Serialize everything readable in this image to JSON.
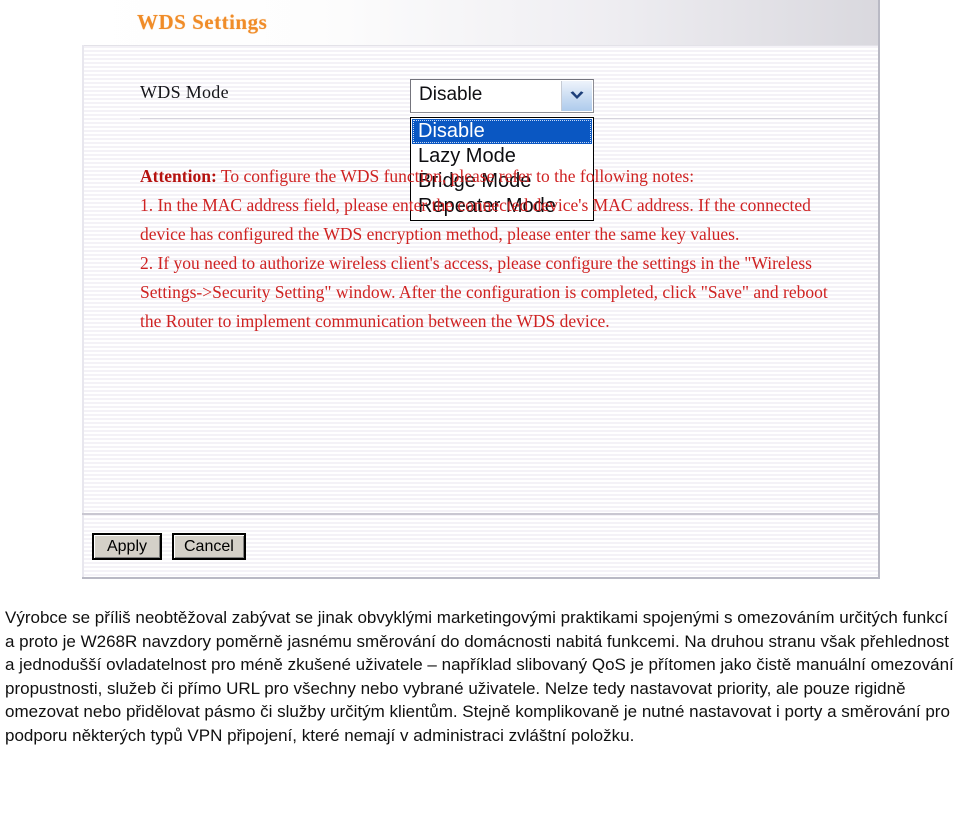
{
  "router_panel": {
    "title": "WDS Settings",
    "wds_mode": {
      "label": "WDS Mode",
      "selected_value": "Disable",
      "arrow_icon": "chevron-down-icon",
      "options": [
        "Disable",
        "Lazy Mode",
        "Bridge Mode",
        "Repeater Mode"
      ]
    },
    "attention": {
      "label": "Attention:",
      "intro": " To configure the WDS function, please refer to the following notes:",
      "line1": "1. In the MAC address field, please enter the connected device's MAC address. If the connected device has configured the WDS encryption method, please enter the same key values.",
      "line2": "2. If you need to authorize wireless client's access, please configure the settings in the \"Wireless Settings->Security Setting\" window. After the configuration is completed, click \"Save\" and reboot the Router to implement communication between the WDS device."
    },
    "buttons": {
      "apply": "Apply",
      "cancel": "Cancel"
    },
    "colors": {
      "title": "#F08C28",
      "attention_bold": "#B5110F",
      "attention_body": "#CF2222",
      "option_highlight": "#0A57C2"
    }
  },
  "article": {
    "paragraph": "Výrobce se příliš neobtěžoval zabývat se jinak obvyklými marketingovými praktikami spojenými s omezováním určitých funkcí a proto je W268R navzdory poměrně jasnému směrování do domácnosti nabitá funkcemi. Na druhou stranu však přehlednost a jednodušší ovladatelnost pro méně zkušené uživatele – například slibovaný QoS je přítomen jako čistě manuální omezování propustnosti, služeb či přímo URL pro všechny nebo vybrané uživatele. Nelze tedy nastavovat priority, ale pouze rigidně omezovat nebo přidělovat pásmo či služby určitým klientům. Stejně komplikovaně je nutné nastavovat i porty a směrování pro podporu některých typů VPN připojení, které nemají v administraci zvláštní položku."
  }
}
